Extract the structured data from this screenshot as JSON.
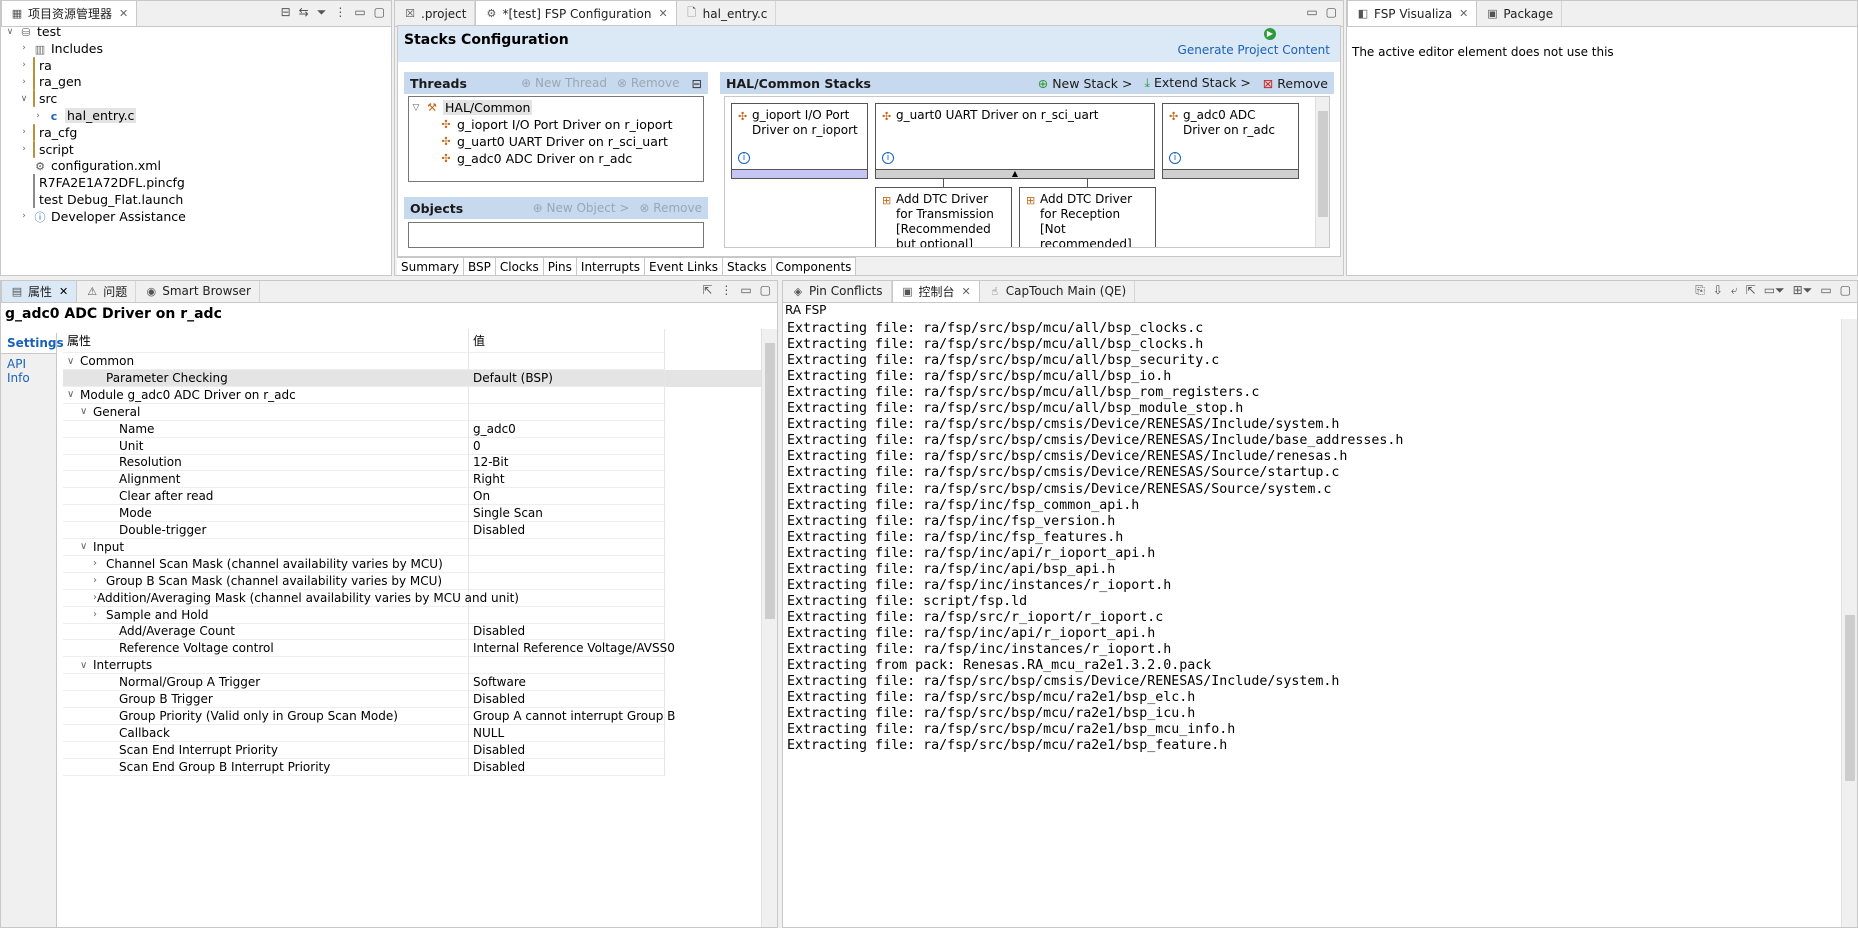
{
  "project_explorer": {
    "tab_label": "项目资源管理器",
    "tree": [
      {
        "label": "test",
        "depth": 0,
        "expanded": true,
        "icon": "project-icon"
      },
      {
        "label": "Includes",
        "depth": 1,
        "icon": "includes-icon"
      },
      {
        "label": "ra",
        "depth": 1,
        "icon": "folder-icon"
      },
      {
        "label": "ra_gen",
        "depth": 1,
        "icon": "folder-icon"
      },
      {
        "label": "src",
        "depth": 1,
        "expanded": true,
        "icon": "folder-icon"
      },
      {
        "label": "hal_entry.c",
        "depth": 2,
        "icon": "c-file-icon",
        "selected": true
      },
      {
        "label": "ra_cfg",
        "depth": 1,
        "icon": "folder-icon"
      },
      {
        "label": "script",
        "depth": 1,
        "icon": "folder-icon"
      },
      {
        "label": "configuration.xml",
        "depth": 1,
        "icon": "gear-icon"
      },
      {
        "label": "R7FA2E1A72DFL.pincfg",
        "depth": 1,
        "icon": "file-icon"
      },
      {
        "label": "test Debug_Flat.launch",
        "depth": 1,
        "icon": "file-icon"
      },
      {
        "label": "Developer Assistance",
        "depth": 1,
        "icon": "help-icon"
      }
    ]
  },
  "editor": {
    "tabs": [
      ".project",
      "*[test] FSP Configuration",
      "hal_entry.c"
    ],
    "title": "Stacks Configuration",
    "generate_label": "Generate Project Content",
    "threads": {
      "label": "Threads",
      "new_thread": "New Thread",
      "remove": "Remove",
      "root": "HAL/Common",
      "items": [
        "g_ioport I/O Port Driver on r_ioport",
        "g_uart0 UART Driver on r_sci_uart",
        "g_adc0 ADC Driver on r_adc"
      ]
    },
    "objects": {
      "label": "Objects",
      "new_object": "New Object >",
      "remove": "Remove"
    },
    "stacks": {
      "label": "HAL/Common Stacks",
      "new_stack": "New Stack >",
      "extend_stack": "Extend Stack >",
      "remove": "Remove",
      "blocks": [
        "g_ioport I/O Port Driver on r_ioport",
        "g_uart0 UART Driver on r_sci_uart",
        "g_adc0 ADC Driver on r_adc"
      ],
      "dtc_tx": "Add DTC Driver for Transmission [Recommended but optional]",
      "dtc_rx": "Add DTC Driver for Reception [Not recommended]"
    },
    "bottom_tabs": [
      "Summary",
      "BSP",
      "Clocks",
      "Pins",
      "Interrupts",
      "Event Links",
      "Stacks",
      "Components"
    ]
  },
  "right_panel": {
    "tabs": [
      "FSP Visualiza",
      "Package"
    ],
    "message": "The active editor element does not use this"
  },
  "properties": {
    "tabs": [
      "属性",
      "问题",
      "Smart Browser"
    ],
    "title": "g_adc0 ADC Driver on r_adc",
    "side_tabs": [
      "Settings",
      "API Info"
    ],
    "col_property": "属性",
    "col_value": "值",
    "rows": [
      {
        "name": "Common",
        "value": "",
        "indent": 0,
        "chev": "v"
      },
      {
        "name": "Parameter Checking",
        "value": "Default (BSP)",
        "indent": 2,
        "chev": "",
        "selected": true
      },
      {
        "name": "Module g_adc0 ADC Driver on r_adc",
        "value": "",
        "indent": 0,
        "chev": "v"
      },
      {
        "name": "General",
        "value": "",
        "indent": 1,
        "chev": "v"
      },
      {
        "name": "Name",
        "value": "g_adc0",
        "indent": 3,
        "chev": ""
      },
      {
        "name": "Unit",
        "value": "0",
        "indent": 3,
        "chev": ""
      },
      {
        "name": "Resolution",
        "value": "12-Bit",
        "indent": 3,
        "chev": ""
      },
      {
        "name": "Alignment",
        "value": "Right",
        "indent": 3,
        "chev": ""
      },
      {
        "name": "Clear after read",
        "value": "On",
        "indent": 3,
        "chev": ""
      },
      {
        "name": "Mode",
        "value": "Single Scan",
        "indent": 3,
        "chev": ""
      },
      {
        "name": "Double-trigger",
        "value": "Disabled",
        "indent": 3,
        "chev": ""
      },
      {
        "name": "Input",
        "value": "",
        "indent": 1,
        "chev": "v"
      },
      {
        "name": "Channel Scan Mask (channel availability varies by MCU)",
        "value": "",
        "indent": 2,
        "chev": ">"
      },
      {
        "name": "Group B Scan Mask (channel availability varies by MCU)",
        "value": "",
        "indent": 2,
        "chev": ">"
      },
      {
        "name": "Addition/Averaging Mask (channel availability varies by MCU and unit)",
        "value": "",
        "indent": 2,
        "chev": ">"
      },
      {
        "name": "Sample and Hold",
        "value": "",
        "indent": 2,
        "chev": ">"
      },
      {
        "name": "Add/Average Count",
        "value": "Disabled",
        "indent": 3,
        "chev": ""
      },
      {
        "name": "Reference Voltage control",
        "value": "Internal Reference Voltage/AVSS0",
        "indent": 3,
        "chev": ""
      },
      {
        "name": "Interrupts",
        "value": "",
        "indent": 1,
        "chev": "v"
      },
      {
        "name": "Normal/Group A Trigger",
        "value": "Software",
        "indent": 3,
        "chev": ""
      },
      {
        "name": "Group B Trigger",
        "value": "Disabled",
        "indent": 3,
        "chev": ""
      },
      {
        "name": "Group Priority (Valid only in Group Scan Mode)",
        "value": "Group A cannot interrupt Group B",
        "indent": 3,
        "chev": ""
      },
      {
        "name": "Callback",
        "value": "NULL",
        "indent": 3,
        "chev": ""
      },
      {
        "name": "Scan End Interrupt Priority",
        "value": "Disabled",
        "indent": 3,
        "chev": ""
      },
      {
        "name": "Scan End Group B Interrupt Priority",
        "value": "Disabled",
        "indent": 3,
        "chev": ""
      }
    ]
  },
  "console": {
    "tabs": [
      "Pin Conflicts",
      "控制台",
      "CapTouch Main (QE)"
    ],
    "title": "RA FSP",
    "lines": [
      "Extracting file: ra/fsp/src/bsp/mcu/all/bsp_clocks.c",
      "Extracting file: ra/fsp/src/bsp/mcu/all/bsp_clocks.h",
      "Extracting file: ra/fsp/src/bsp/mcu/all/bsp_security.c",
      "Extracting file: ra/fsp/src/bsp/mcu/all/bsp_io.h",
      "Extracting file: ra/fsp/src/bsp/mcu/all/bsp_rom_registers.c",
      "Extracting file: ra/fsp/src/bsp/mcu/all/bsp_module_stop.h",
      "Extracting file: ra/fsp/src/bsp/cmsis/Device/RENESAS/Include/system.h",
      "Extracting file: ra/fsp/src/bsp/cmsis/Device/RENESAS/Include/base_addresses.h",
      "Extracting file: ra/fsp/src/bsp/cmsis/Device/RENESAS/Include/renesas.h",
      "Extracting file: ra/fsp/src/bsp/cmsis/Device/RENESAS/Source/startup.c",
      "Extracting file: ra/fsp/src/bsp/cmsis/Device/RENESAS/Source/system.c",
      "Extracting file: ra/fsp/inc/fsp_common_api.h",
      "Extracting file: ra/fsp/inc/fsp_version.h",
      "Extracting file: ra/fsp/inc/fsp_features.h",
      "Extracting file: ra/fsp/inc/api/r_ioport_api.h",
      "Extracting file: ra/fsp/inc/api/bsp_api.h",
      "Extracting file: ra/fsp/inc/instances/r_ioport.h",
      "Extracting file: script/fsp.ld",
      "Extracting file: ra/fsp/src/r_ioport/r_ioport.c",
      "Extracting file: ra/fsp/inc/api/r_ioport_api.h",
      "Extracting file: ra/fsp/inc/instances/r_ioport.h",
      "Extracting from pack: Renesas.RA_mcu_ra2e1.3.2.0.pack",
      "Extracting file: ra/fsp/src/bsp/cmsis/Device/RENESAS/Include/system.h",
      "Extracting file: ra/fsp/src/bsp/mcu/ra2e1/bsp_elc.h",
      "Extracting file: ra/fsp/src/bsp/mcu/ra2e1/bsp_icu.h",
      "Extracting file: ra/fsp/src/bsp/mcu/ra2e1/bsp_mcu_info.h",
      "Extracting file: ra/fsp/src/bsp/mcu/ra2e1/bsp_feature.h"
    ]
  },
  "colors": {
    "accent": "#1a62b8",
    "section": "#c7d9ee",
    "selection": "#e4e4e4"
  }
}
